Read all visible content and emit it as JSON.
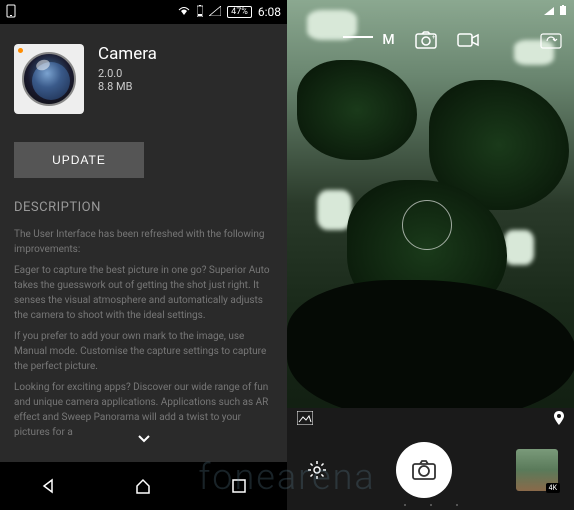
{
  "left": {
    "status": {
      "battery_pct": "47%",
      "time": "6:08"
    },
    "app": {
      "name": "Camera",
      "version": "2.0.0",
      "size": "8.8 MB"
    },
    "update_label": "UPDATE",
    "description": {
      "title": "DESCRIPTION",
      "p1": "The User Interface has been refreshed with the following improvements:",
      "p2": "Eager to capture the best picture in one go? Superior Auto takes the guesswork out of getting the shot just right. It senses the visual atmosphere and automatically adjusts the camera to shoot with the ideal settings.",
      "p3": "If you prefer to add your own mark to the image, use Manual mode. Customise the capture settings to capture the perfect picture.",
      "p4": "Looking for exciting apps? Discover our wide range of fun and unique camera applications. Applications such as AR effect and Sweep Panorama will add a twist to your pictures for a"
    }
  },
  "right": {
    "mode": "M",
    "resolution_badge": "4K"
  },
  "watermark": "fonearena"
}
